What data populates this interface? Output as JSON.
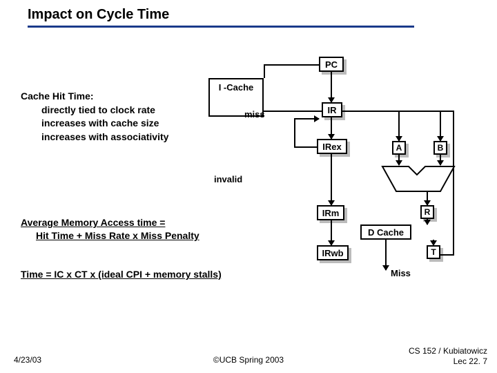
{
  "title": "Impact on Cycle Time",
  "hit": {
    "head": "Cache Hit Time:",
    "l1": "directly tied to clock rate",
    "l2": "increases with cache size",
    "l3": "increases with associativity"
  },
  "boxes": {
    "pc": "PC",
    "icache": "I -Cache",
    "ir": "IR",
    "irex": "IRex",
    "irm": "IRm",
    "irwb": "IRwb",
    "a": "A",
    "b": "B",
    "r": "R",
    "dcache": "D Cache",
    "t": "T"
  },
  "labels": {
    "miss": "miss",
    "invalid": "invalid",
    "miss2": "Miss"
  },
  "formulas": {
    "amat1": "Average Memory Access time =",
    "amat2": "Hit Time + Miss Rate x Miss Penalty",
    "time": "Time = IC x CT x (ideal CPI + memory stalls)"
  },
  "footer": {
    "date": "4/23/03",
    "copyright": "©UCB Spring 2003",
    "course1": "CS 152 / Kubiatowicz",
    "course2": "Lec 22. 7"
  }
}
